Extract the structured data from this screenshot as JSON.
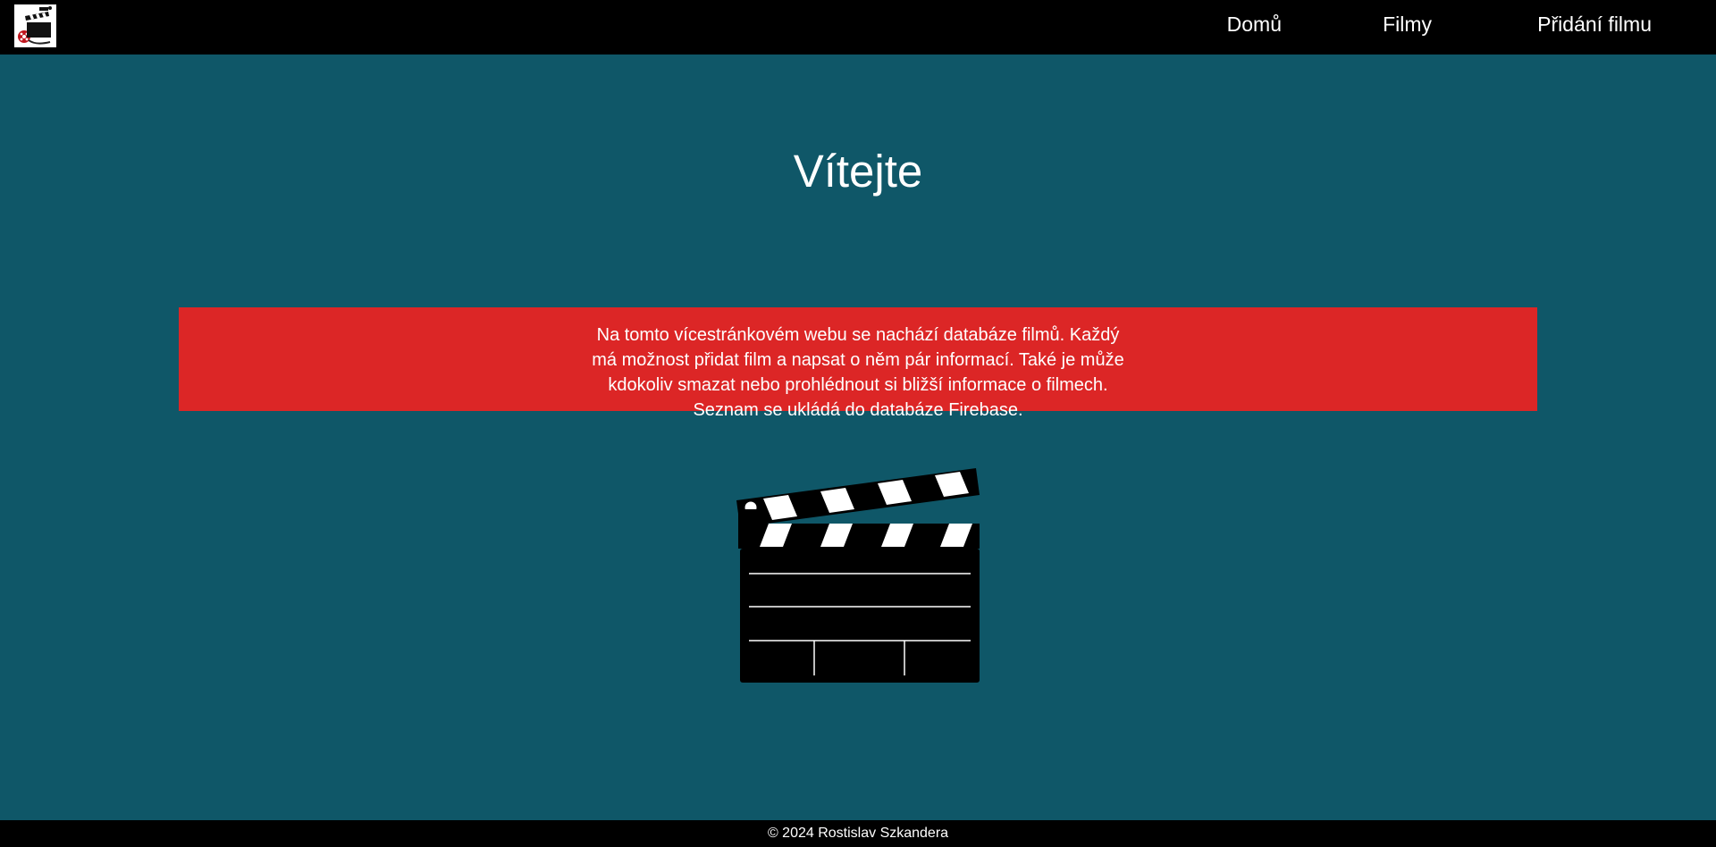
{
  "nav": {
    "logo_icon": "film-clapperboard-logo-icon",
    "items": [
      {
        "label": "Domů"
      },
      {
        "label": "Filmy"
      },
      {
        "label": "Přidání filmu"
      }
    ]
  },
  "main": {
    "title": "Vítejte",
    "info_text": "Na tomto vícestránkovém webu se nachází databáze filmů. Každý má možnost přidat film a napsat o něm pár informací. Také je může kdokoliv smazat nebo prohlédnout si bližší informace o filmech. Seznam se ukládá do databáze Firebase.",
    "image_icon": "clapperboard-icon"
  },
  "footer": {
    "text": "© 2024 Rostislav Szkandera"
  },
  "colors": {
    "background": "#0f5768",
    "navbar": "#000000",
    "info_box": "#dc2626",
    "text": "#ffffff"
  }
}
